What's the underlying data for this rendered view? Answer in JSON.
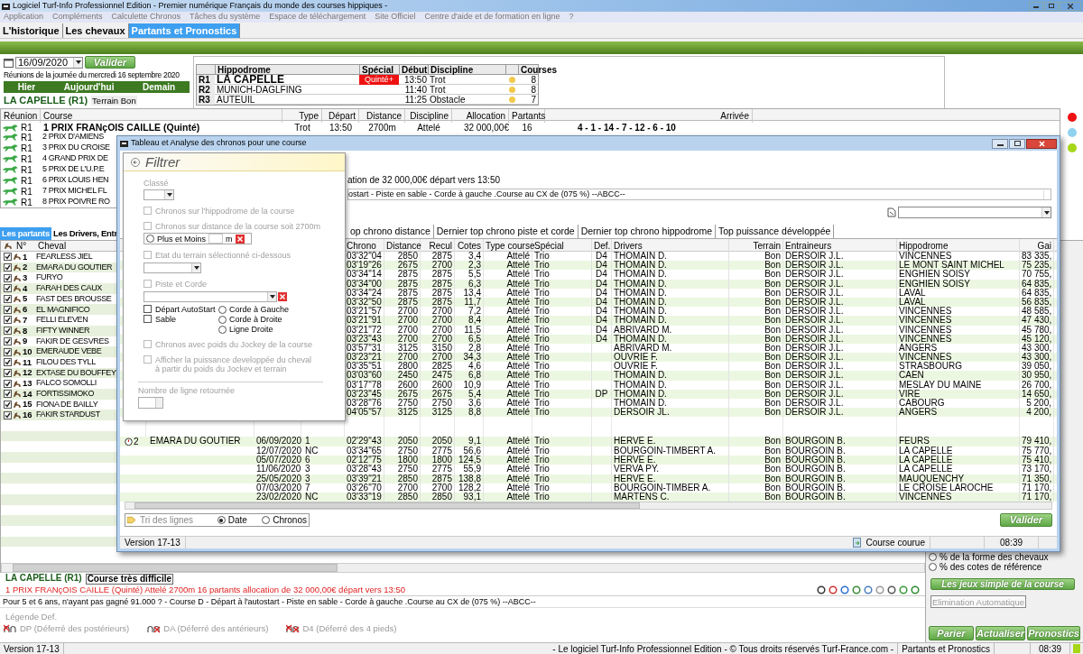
{
  "window": {
    "title": "Logiciel Turf-Info Professionnel Edition - Premier numérique Français du monde des courses hippiques -"
  },
  "menu": [
    "Application",
    "Compléments",
    "Calculette Chronos",
    "Tâches du système",
    "Espace de téléchargement",
    "Site Officiel",
    "Centre d'aide et de formation en ligne",
    "?"
  ],
  "tabs": [
    {
      "label": "L'historique",
      "selected": false
    },
    {
      "label": "Les chevaux",
      "selected": false
    },
    {
      "label": "Partants et Pronostics",
      "selected": true
    }
  ],
  "date": {
    "value": "16/09/2020",
    "button": "Valider"
  },
  "meetings_caption": "Réunions de la journée du mercredi 16 septembre 2020",
  "day_nav": [
    "Hier",
    "Aujourd'hui",
    "Demain"
  ],
  "meeting": {
    "name": "LA CAPELLE (R1)",
    "terrain": "Terrain Bon"
  },
  "hippodromes": {
    "columns": [
      "Hippodrome",
      "Spécial",
      "Début",
      "Discipline",
      "Courses"
    ],
    "rows": [
      {
        "code": "R1",
        "name": "LA CAPELLE",
        "special": "Quinté+",
        "start": "13:50",
        "discipline": "Trot",
        "courses": "8",
        "selected": true,
        "color": "#f2c94c"
      },
      {
        "code": "R2",
        "name": "MUNICH-DAGLFING",
        "start": "11:40",
        "discipline": "Trot",
        "courses": "8",
        "selected": false,
        "color": "#f2c94c"
      },
      {
        "code": "R3",
        "name": "AUTEUIL",
        "start": "11:25",
        "discipline": "Obstacle",
        "courses": "7",
        "selected": false,
        "color": "#f2c94c"
      }
    ]
  },
  "races": {
    "columns": [
      "Réunion",
      "Course",
      "Type",
      "Départ",
      "Distance",
      "Discipline",
      "Allocation",
      "Partants",
      "Arrivée"
    ],
    "rows": [
      {
        "reunion": "R1",
        "course": "1 PRIX FRANçOIS CAILLE (Quinté)",
        "type": "Trot",
        "depart": "13:50",
        "distance": "2700m",
        "discipline": "Attelé",
        "allocation": "32 000,00€",
        "partants": "16",
        "arrivee": "4 - 1 - 14 - 7 - 12 - 6 - 10",
        "selected": true
      },
      {
        "reunion": "R1",
        "course": "2 PRIX D'AMIENS",
        "selected": false
      },
      {
        "reunion": "R1",
        "course": "3 PRIX DU CROISE",
        "selected": false
      },
      {
        "reunion": "R1",
        "course": "4 GRAND PRIX DE",
        "selected": false
      },
      {
        "reunion": "R1",
        "course": "5 PRIX DE L'U.P.E",
        "selected": false
      },
      {
        "reunion": "R1",
        "course": "6 PRIX LOUIS HEN",
        "selected": false
      },
      {
        "reunion": "R1",
        "course": "7 PRIX MICHEL FL",
        "selected": false
      },
      {
        "reunion": "R1",
        "course": "8 PRIX POIVRE RO",
        "selected": false
      }
    ]
  },
  "status_dots": [
    {
      "color": "#ee1111"
    },
    {
      "color": "#8fd3ef"
    },
    {
      "color": "#a6d617"
    }
  ],
  "runner_tabs": [
    {
      "label": "Les partants",
      "selected": true
    },
    {
      "label": "Les Drivers, Entr",
      "selected": false
    }
  ],
  "runners": {
    "columns": [
      "N°",
      "Cheval"
    ],
    "rows": [
      {
        "number": "1",
        "name": "FEARLESS JIEL",
        "checked": true
      },
      {
        "number": "2",
        "name": "EMARA DU GOUTIER",
        "checked": true
      },
      {
        "number": "3",
        "name": "FURYO",
        "checked": true
      },
      {
        "number": "4",
        "name": "FARAH DES CAUX",
        "checked": true
      },
      {
        "number": "5",
        "name": "FAST DES BROUSSE",
        "checked": true
      },
      {
        "number": "6",
        "name": "EL MAGNIFICO",
        "checked": true
      },
      {
        "number": "7",
        "name": "FELLI ELEVEN",
        "checked": true
      },
      {
        "number": "8",
        "name": "FIFTY WINNER",
        "checked": true
      },
      {
        "number": "9",
        "name": "FAKIR DE GESVRES",
        "checked": true
      },
      {
        "number": "10",
        "name": "EMERAUDE VEBE",
        "checked": true
      },
      {
        "number": "11",
        "name": "FILOU DES TYLL",
        "checked": true
      },
      {
        "number": "12",
        "name": "EXTASE DU BOUFFEY",
        "checked": true
      },
      {
        "number": "13",
        "name": "FALCO SOMOLLI",
        "checked": true
      },
      {
        "number": "14",
        "name": "FORTISSIMOKO",
        "checked": true
      },
      {
        "number": "15",
        "name": "FIONA DE BAILLY",
        "checked": true
      },
      {
        "number": "16",
        "name": "FAKIR STARDUST",
        "checked": true
      }
    ]
  },
  "dialog": {
    "title": "Tableau et Analyse des chronos pour une course",
    "info": "ation de 32 000,00€ départ vers 13:50",
    "conditions": "ostart - Piste en sable - Corde à gauche .Course au CX de (075 %)  --ABCC--",
    "tabs": [
      {
        "label": "op chrono distance",
        "selected": false
      },
      {
        "label": "Dernier top chrono piste et corde",
        "selected": false
      },
      {
        "label": "Dernier top chrono hippodrome",
        "selected": false
      },
      {
        "label": "Top puissance développée",
        "selected": false
      }
    ],
    "columns": [
      "Chrono",
      "Distance",
      "Recul",
      "Cotes",
      "Type course",
      "Spécial",
      "Def.",
      "Drivers",
      "Terrain",
      "Entraineurs",
      "Hippodrome",
      "Gai"
    ],
    "rows": [
      [
        "03'32\"04",
        "2850",
        "2875",
        "3,4",
        "Attelé",
        "Trio",
        "D4",
        "THOMAIN D.",
        "Bon",
        "DERSOIR J.L.",
        "VINCENNES",
        "83 335,"
      ],
      [
        "03'19\"26",
        "2675",
        "2700",
        "2,3",
        "Attelé",
        "Trio",
        "D4",
        "THOMAIN D.",
        "Bon",
        "DERSOIR J.L.",
        "LE MONT SAINT MICHEL",
        "75 235,"
      ],
      [
        "03'34\"14",
        "2875",
        "2875",
        "5,5",
        "Attelé",
        "Trio",
        "D4",
        "THOMAIN D.",
        "Bon",
        "DERSOIR J.L.",
        "ENGHIEN SOISY",
        "70 755,"
      ],
      [
        "03'34\"00",
        "2875",
        "2875",
        "6,3",
        "Attelé",
        "Trio",
        "D4",
        "THOMAIN D.",
        "Bon",
        "DERSOIR J.L.",
        "ENGHIEN SOISY",
        "64 835,"
      ],
      [
        "03'34\"24",
        "2875",
        "2875",
        "13,4",
        "Attelé",
        "Trio",
        "D4",
        "THOMAIN D.",
        "Bon",
        "DERSOIR J.L.",
        "LAVAL",
        "64 835,"
      ],
      [
        "03'32\"50",
        "2875",
        "2875",
        "11,7",
        "Attelé",
        "Trio",
        "D4",
        "THOMAIN D.",
        "Bon",
        "DERSOIR J.L.",
        "LAVAL",
        "56 835,"
      ],
      [
        "03'21\"57",
        "2700",
        "2700",
        "7,2",
        "Attelé",
        "Trio",
        "D4",
        "THOMAIN D.",
        "Bon",
        "DERSOIR J.L.",
        "VINCENNES",
        "48 585,"
      ],
      [
        "03'21\"91",
        "2700",
        "2700",
        "8,4",
        "Attelé",
        "Trio",
        "D4",
        "THOMAIN D.",
        "Bon",
        "DERSOIR J.L.",
        "VINCENNES",
        "47 430,"
      ],
      [
        "03'21\"72",
        "2700",
        "2700",
        "11,5",
        "Attelé",
        "Trio",
        "D4",
        "ABRIVARD M.",
        "Bon",
        "DERSOIR J.L.",
        "VINCENNES",
        "45 780,"
      ],
      [
        "03'23\"43",
        "2700",
        "2700",
        "6,5",
        "Attelé",
        "Trio",
        "D4",
        "THOMAIN D.",
        "Bon",
        "DERSOIR J.L.",
        "VINCENNES",
        "45 120,"
      ],
      [
        "03'57\"31",
        "3125",
        "3150",
        "2,8",
        "Attelé",
        "Trio",
        "",
        "ABRIVARD M.",
        "Bon",
        "DERSOIR J.L.",
        "ANGERS",
        "43 300,"
      ],
      [
        "03'23\"21",
        "2700",
        "2700",
        "34,3",
        "Attelé",
        "Trio",
        "",
        "OUVRIE F.",
        "Bon",
        "DERSOIR J.L.",
        "VINCENNES",
        "43 300,"
      ],
      [
        "03'35\"51",
        "2800",
        "2825",
        "4,6",
        "Attelé",
        "Trio",
        "",
        "OUVRIE F.",
        "Bon",
        "DERSOIR J.L.",
        "STRASBOURG",
        "39 050,"
      ],
      [
        "03'03\"60",
        "2450",
        "2475",
        "6,8",
        "Attelé",
        "Trio",
        "",
        "THOMAIN D.",
        "Bon",
        "DERSOIR J.L.",
        "CAEN",
        "30 950,"
      ],
      [
        "03'17\"78",
        "2600",
        "2600",
        "10,9",
        "Attelé",
        "Trio",
        "",
        "THOMAIN D.",
        "Bon",
        "DERSOIR J.L.",
        "MESLAY DU MAINE",
        "26 700,"
      ],
      [
        "03'23\"45",
        "2675",
        "2675",
        "5,4",
        "Attelé",
        "Trio",
        "DP",
        "THOMAIN D.",
        "Bon",
        "DERSOIR J.L.",
        "VIRE",
        "14 650,"
      ],
      [
        "03'28\"76",
        "2750",
        "2750",
        "3,6",
        "Attelé",
        "Trio",
        "",
        "THOMAIN D.",
        "Bon",
        "DERSOIR J.L.",
        "CABOURG",
        "5 200,"
      ],
      [
        "04'05\"57",
        "3125",
        "3125",
        "8,8",
        "Attelé",
        "Trio",
        "",
        "DERSOIR JL.",
        "Bon",
        "DERSOIR J.L.",
        "ANGERS",
        "4 200,"
      ]
    ],
    "horse_rows": [
      {
        "number": "2",
        "horse": "EMARA DU GOUTIER",
        "date": "06/09/2020",
        "place": "1",
        "cells": [
          "02'29\"43",
          "2050",
          "2050",
          "9,1",
          "Attelé",
          "Trio",
          "",
          "HERVE E.",
          "Bon",
          "BOURGOIN B.",
          "FEURS",
          "79 410,"
        ]
      },
      {
        "date": "12/07/2020",
        "place": "NC",
        "cells": [
          "03'34\"65",
          "2750",
          "2775",
          "56,6",
          "Attelé",
          "Trio",
          "",
          "BOURGOIN-TIMBERT A.",
          "Bon",
          "BOURGOIN B.",
          "LA CAPELLE",
          "75 770,"
        ]
      },
      {
        "date": "05/07/2020",
        "place": "6",
        "cells": [
          "02'12\"75",
          "1800",
          "1800",
          "124,5",
          "Attelé",
          "Trio",
          "",
          "HERVE E.",
          "Bon",
          "BOURGOIN B.",
          "LA CAPELLE",
          "75 410,"
        ]
      },
      {
        "date": "11/06/2020",
        "place": "3",
        "cells": [
          "03'28\"43",
          "2750",
          "2775",
          "55,9",
          "Attelé",
          "Trio",
          "",
          "VERVA PY.",
          "Bon",
          "BOURGOIN B.",
          "LA CAPELLE",
          "73 170,"
        ]
      },
      {
        "date": "25/05/2020",
        "place": "3",
        "cells": [
          "03'39\"21",
          "2850",
          "2875",
          "138,8",
          "Attelé",
          "Trio",
          "",
          "HERVE E.",
          "Bon",
          "BOURGOIN B.",
          "MAUQUENCHY",
          "71 350,"
        ]
      },
      {
        "date": "07/03/2020",
        "place": "7",
        "cells": [
          "03'26\"70",
          "2700",
          "2700",
          "128,2",
          "Attelé",
          "Trio",
          "",
          "BOURGOIN-TIMBER A.",
          "Bon",
          "BOURGOIN B.",
          "LE CROISE LAROCHE",
          "71 170,"
        ]
      },
      {
        "date": "23/02/2020",
        "place": "NC",
        "cells": [
          "03'33\"19",
          "2850",
          "2850",
          "93,1",
          "Attelé",
          "Trio",
          "",
          "MARTENS C.",
          "Bon",
          "BOURGOIN B.",
          "VINCENNES",
          "71 170,"
        ]
      }
    ],
    "sort": {
      "label": "Tri des lignes",
      "options": [
        {
          "label": "Date",
          "selected": true
        },
        {
          "label": "Chronos",
          "selected": false
        }
      ]
    },
    "validate": "Valider",
    "status": {
      "version": "Version 17-13",
      "course": "Course courue",
      "time": "08:39"
    }
  },
  "filter": {
    "title": "Filtrer",
    "classe": "Classé",
    "hippodrome": {
      "label": "Chronos sur l'hippodrome de la course",
      "checked": false,
      "disabled": true
    },
    "distance": {
      "label": "Chronos sur distance de  la course soit 2700m",
      "checked": false,
      "disabled": true
    },
    "plus_moins": {
      "label": "Plus et Moins",
      "unit": "m",
      "selected": false
    },
    "terrain": {
      "label": "Etat du terrain sélectionné ci-dessous",
      "checked": false,
      "disabled": true
    },
    "piste": {
      "label": "Piste et Corde",
      "checked": false,
      "disabled": true
    },
    "surface": [
      {
        "label": "Départ AutoStart",
        "checked": false
      },
      {
        "label": "Sable",
        "checked": false
      }
    ],
    "corde": [
      {
        "label": "Corde à Gauche",
        "selected": false
      },
      {
        "label": "Corde à Droite",
        "selected": false
      },
      {
        "label": "Ligne Droite",
        "selected": false
      }
    ],
    "jockey": {
      "label": "Chronos avec poids du Jockey de la course",
      "checked": false,
      "disabled": true
    },
    "puissance": {
      "label": "Afficher la puissance developpée du cheval à partir du poids du Jockev et terrain",
      "checked": false,
      "disabled": true
    },
    "lines_label": "Nombre de ligne retournée"
  },
  "summary": {
    "meeting": "LA CAPELLE (R1)",
    "difficulty": "Course très difficile",
    "race": "1 PRIX FRANçOIS CAILLE (Quinté) Attelé 2700m 16 partants allocation de 32 000,00€ départ vers 13:50",
    "conditions": "Pour 5 et 6 ans, n'ayant pas gagné 91.000 ? - Course D - Départ à l'autostart - Piste en sable - Corde à gauche .Course au CX de (075 %)  --ABCC--"
  },
  "legend": {
    "title": "Légende Def.",
    "items": [
      {
        "kind": "DP",
        "label": "DP (Déferré des postérieurs)"
      },
      {
        "kind": "DA",
        "label": "DA (Déferré des antérieurs)"
      },
      {
        "kind": "D4",
        "label": "D4 (Déferré des 4 pieds)"
      }
    ]
  },
  "side_panel": {
    "options": [
      {
        "label": "% de la forme des chevaux",
        "selected": false
      },
      {
        "label": "% des cotes de référence",
        "selected": false
      }
    ],
    "games": "Les jeux simple de la course",
    "elimination": {
      "label": "Elimination Automatique",
      "disabled": true
    },
    "actions": [
      "Parier",
      "Actualiser",
      "Pronostics"
    ]
  },
  "status_bar": {
    "version": "Version 17-13",
    "copyright": "- Le logiciel Turf-Info Professionnel Edition - © Tous droits réservés Turf-France.com -",
    "section": "Partants et Pronostics",
    "time": "08:39"
  }
}
